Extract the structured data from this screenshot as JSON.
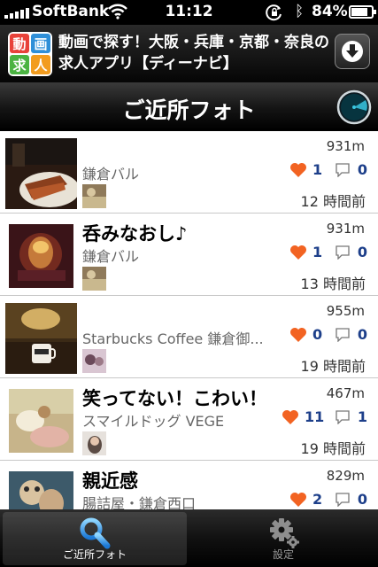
{
  "status_bar": {
    "carrier": "SoftBank",
    "time": "11:12",
    "battery": "84%",
    "battery_level": 0.84
  },
  "ad": {
    "logo_chars": [
      "動",
      "画",
      "求",
      "人"
    ],
    "logo_colors": [
      "#e8423a",
      "#2f8fd8",
      "#4bb342",
      "#f29c1f"
    ],
    "text": "動画で探す！大阪・兵庫・京都・奈良の求人アプリ【ディーナビ】",
    "download_icon": "download-icon"
  },
  "nav": {
    "title": "ご近所フォト",
    "radar_icon": "radar-icon"
  },
  "accent": {
    "heart": "#f26322",
    "count": "#1d3f8a"
  },
  "photos": [
    {
      "title": "",
      "place": "鎌倉バル",
      "distance": "931m",
      "likes": "1",
      "comments": "0",
      "time": "12 時間前"
    },
    {
      "title": "呑みなおし♪",
      "place": "鎌倉バル",
      "distance": "931m",
      "likes": "1",
      "comments": "0",
      "time": "13 時間前"
    },
    {
      "title": "",
      "place": "Starbucks Coffee 鎌倉御...",
      "distance": "955m",
      "likes": "0",
      "comments": "0",
      "time": "19 時間前"
    },
    {
      "title": "笑ってない！こわい！",
      "place": "スマイルドッグ VEGE",
      "distance": "467m",
      "likes": "11",
      "comments": "1",
      "time": "19 時間前"
    },
    {
      "title": "親近感",
      "place": "腸詰屋・鎌倉西口",
      "distance": "829m",
      "likes": "2",
      "comments": "0",
      "time": ""
    }
  ],
  "tabs": [
    {
      "label": "ご近所フォト",
      "icon": "search-icon",
      "active": true
    },
    {
      "label": "設定",
      "icon": "gear-icon",
      "active": false
    }
  ]
}
